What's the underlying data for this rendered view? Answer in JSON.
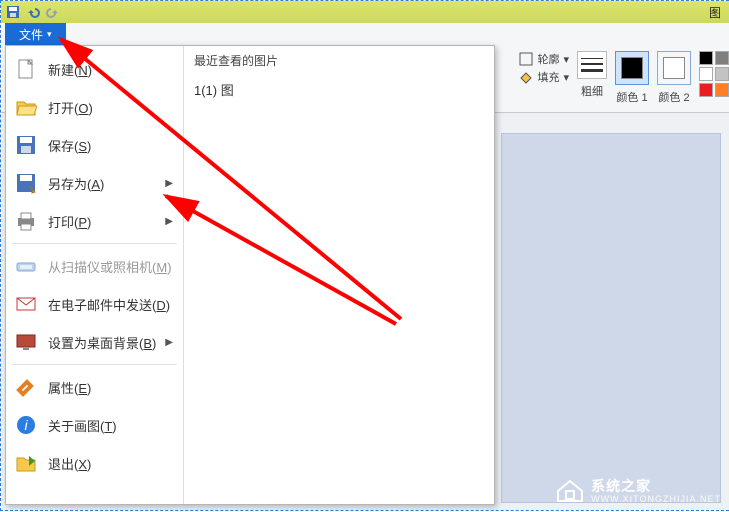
{
  "titlebar": {
    "right_label": "图"
  },
  "filetab": {
    "label": "文件"
  },
  "ribbon": {
    "outline": "轮廓",
    "fill": "填充",
    "stroke": "粗细",
    "color1": "颜色 1",
    "color2": "颜色 2"
  },
  "menu": {
    "recent_header": "最近查看的图片",
    "recent_items": [
      "1(1) 图"
    ],
    "items": [
      {
        "label_pre": "新建(",
        "hot": "N",
        "label_post": ")",
        "icon": "new",
        "arrow": false
      },
      {
        "label_pre": "打开(",
        "hot": "O",
        "label_post": ")",
        "icon": "open",
        "arrow": false
      },
      {
        "label_pre": "保存(",
        "hot": "S",
        "label_post": ")",
        "icon": "save",
        "arrow": false
      },
      {
        "label_pre": "另存为(",
        "hot": "A",
        "label_post": ")",
        "icon": "saveas",
        "arrow": true
      },
      {
        "label_pre": "打印(",
        "hot": "P",
        "label_post": ")",
        "icon": "print",
        "arrow": true
      },
      {
        "label_pre": "从扫描仪或照相机(",
        "hot": "M",
        "label_post": ")",
        "icon": "scan",
        "arrow": false,
        "disabled": true
      },
      {
        "label_pre": "在电子邮件中发送(",
        "hot": "D",
        "label_post": ")",
        "icon": "email",
        "arrow": false
      },
      {
        "label_pre": "设置为桌面背景(",
        "hot": "B",
        "label_post": ")",
        "icon": "desktop",
        "arrow": true
      },
      {
        "label_pre": "属性(",
        "hot": "E",
        "label_post": ")",
        "icon": "prop",
        "arrow": false
      },
      {
        "label_pre": "关于画图(",
        "hot": "T",
        "label_post": ")",
        "icon": "about",
        "arrow": false
      },
      {
        "label_pre": "退出(",
        "hot": "X",
        "label_post": ")",
        "icon": "exit",
        "arrow": false
      }
    ]
  },
  "colors": {
    "color1": "#000000",
    "color2": "#ffffff",
    "palette": [
      "#000000",
      "#7f7f7f",
      "#ffffff",
      "#c3c3c3",
      "#ed1c24",
      "#ff7f27"
    ]
  },
  "watermark": {
    "line1": "系统之家",
    "line2": "WWW.XITONGZHIJIA.NET"
  }
}
